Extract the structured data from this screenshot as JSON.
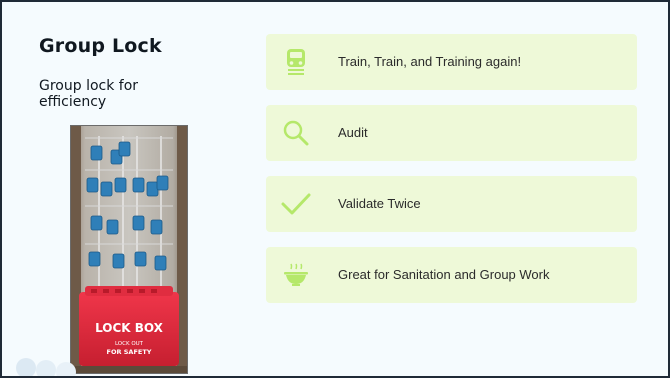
{
  "slide": {
    "title": "Group Lock",
    "subtitle": "Group lock for efficiency",
    "lockbox_text": "LOCK BOX",
    "lockbox_subtext": "LOCK OUT",
    "lockbox_subtext2": "FOR SAFETY",
    "items": [
      {
        "label": "Train, Train, and Training again!",
        "icon": "train-icon"
      },
      {
        "label": "Audit",
        "icon": "magnifier-icon"
      },
      {
        "label": "Validate Twice",
        "icon": "checkmark-icon"
      },
      {
        "label": "Great for Sanitation and Group Work",
        "icon": "sanitation-bowl-icon"
      }
    ],
    "colors": {
      "card_background": "#eef9d8",
      "icon_green": "#b5e86a",
      "slide_background": "#f5fbfe",
      "lock_blue": "#2f7fb8",
      "lockbox_red": "#e0283a"
    }
  }
}
